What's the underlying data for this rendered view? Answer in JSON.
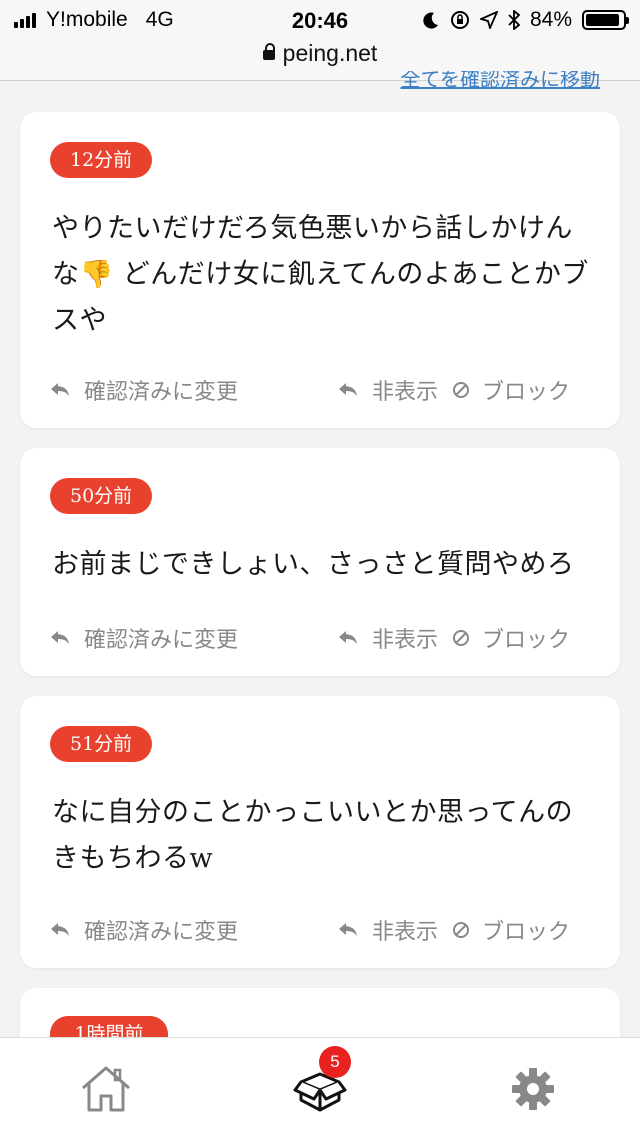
{
  "status_bar": {
    "carrier": "Y!mobile",
    "network": "4G",
    "time": "20:46",
    "battery": "84%"
  },
  "browser": {
    "url": "peing.net",
    "top_link": "全てを確認済みに移動"
  },
  "messages": [
    {
      "time": "12分前",
      "text": "やりたいだけだろ気色悪いから話しかけんな👎 どんだけ女に飢えてんのよあことかブスや"
    },
    {
      "time": "50分前",
      "text": "お前まじできしょい、さっさと質問やめろ"
    },
    {
      "time": "51分前",
      "text": "なに自分のことかっこいいとか思ってんのきもちわるw"
    },
    {
      "time": "1時間前",
      "text": ""
    }
  ],
  "actions": {
    "confirm": "確認済みに変更",
    "hide": "非表示",
    "block": "ブロック"
  },
  "nav": {
    "badge_count": "5"
  },
  "colors": {
    "accent": "#e8412e",
    "badge": "#e8221f",
    "icon": "#888888"
  }
}
